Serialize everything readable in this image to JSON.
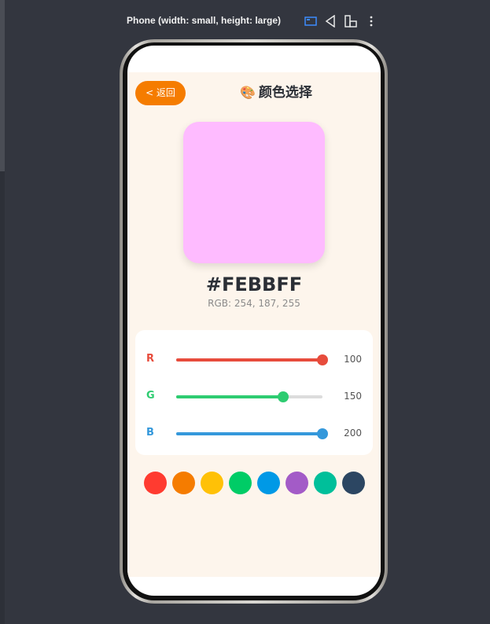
{
  "preview": {
    "title": "Phone (width: small, height: large)",
    "icons": [
      "layout-icon",
      "rotate-icon",
      "device-icon",
      "more-icon"
    ]
  },
  "app": {
    "back_label": "< 返回",
    "title_icon": "🎨",
    "title": "颜色选择",
    "color_hex": "#FEBBFF",
    "color_rgb": "RGB: 254, 187, 255",
    "swatch_color": "#febbff",
    "sliders": [
      {
        "label": "R",
        "value": "100",
        "fraction": 1.0,
        "color": "#e74c3c"
      },
      {
        "label": "G",
        "value": "150",
        "fraction": 0.73,
        "color": "#2ecc71"
      },
      {
        "label": "B",
        "value": "200",
        "fraction": 1.0,
        "color": "#3498db"
      }
    ],
    "presets": [
      "#ff3b30",
      "#f57c00",
      "#ffc107",
      "#00cc66",
      "#0099e6",
      "#a35bc7",
      "#00bf9a",
      "#2c4662"
    ]
  }
}
